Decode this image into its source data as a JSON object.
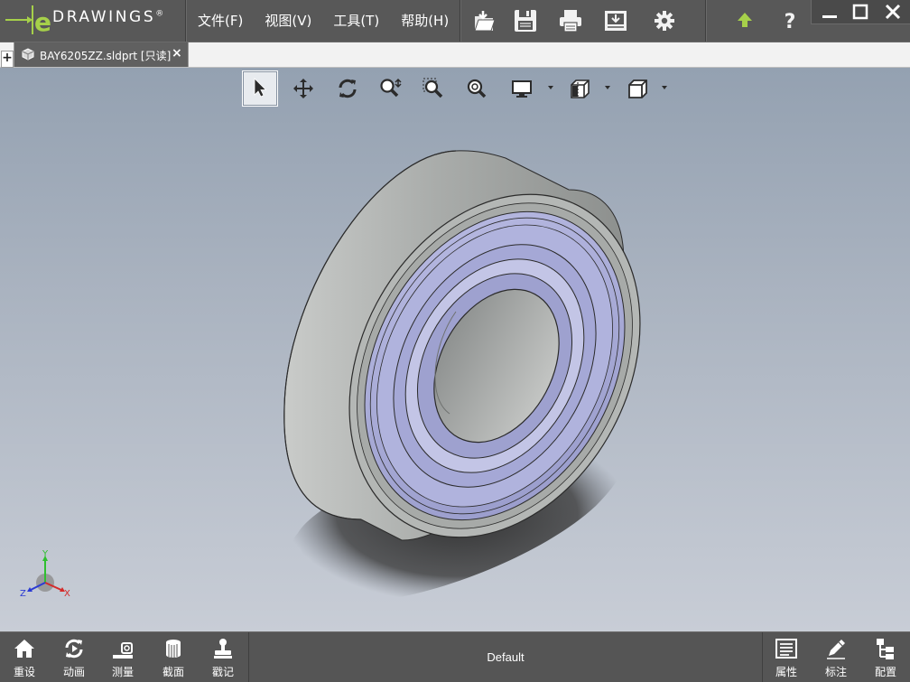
{
  "app": {
    "logo_text": "DRAWINGS",
    "logo_trademark": "®",
    "logo_letter": "e"
  },
  "menu": [
    {
      "label": "文件(F)"
    },
    {
      "label": "视图(V)"
    },
    {
      "label": "工具(T)"
    },
    {
      "label": "帮助(H)"
    }
  ],
  "toolbar_icons": [
    "open-icon",
    "save-icon",
    "print-icon",
    "publish-icon",
    "settings-icon",
    "upload-arrow-icon",
    "help-icon"
  ],
  "window_controls": [
    "minimize-icon",
    "maximize-icon",
    "close-icon"
  ],
  "tab": {
    "add_label": "+",
    "document_title": "BAY6205ZZ.sldprt [只读]",
    "close_label": "×"
  },
  "view_toolbar": {
    "tools": [
      "select-arrow-icon",
      "pan-icon",
      "rotate-icon",
      "zoom-to-fit-icon",
      "zoom-to-area-icon",
      "zoom-icon",
      "display-style-icon",
      "section-view-icon",
      "standard-views-icon"
    ],
    "active_tool": "select-arrow-icon"
  },
  "triad": {
    "x": "X",
    "y": "Y",
    "z": "Z"
  },
  "bottom_left": [
    {
      "label": "重设",
      "icon": "home-icon"
    },
    {
      "label": "动画",
      "icon": "animate-icon"
    },
    {
      "label": "测量",
      "icon": "measure-icon"
    },
    {
      "label": "截面",
      "icon": "section-icon"
    },
    {
      "label": "戳记",
      "icon": "stamp-icon"
    }
  ],
  "configuration": "Default",
  "bottom_right": [
    {
      "label": "属性",
      "icon": "properties-icon"
    },
    {
      "label": "标注",
      "icon": "markup-icon"
    },
    {
      "label": "配置",
      "icon": "configurations-icon"
    }
  ],
  "colors": {
    "chrome": "#585858",
    "logo_green": "#a6d04a",
    "viewport_top": "#94a1b1",
    "viewport_bottom": "#c8cdd6",
    "bearing_shield": "#a8aad6",
    "bearing_race": "#b8bbb9"
  }
}
